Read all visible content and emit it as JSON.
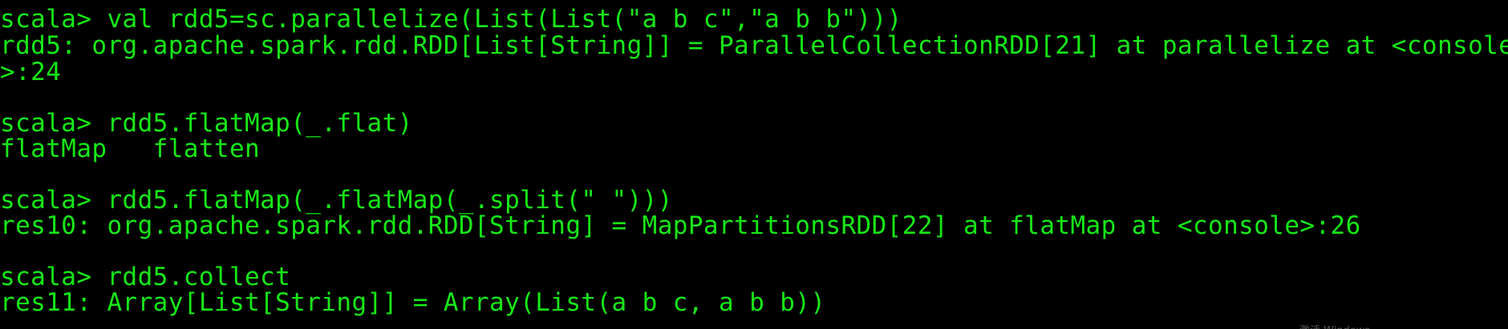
{
  "terminal": {
    "text_color": "#17e817",
    "background_color": "#000000",
    "lines": [
      "scala> val rdd5=sc.parallelize(List(List(\"a b c\",\"a b b\")))",
      "rdd5: org.apache.spark.rdd.RDD[List[String]] = ParallelCollectionRDD[21] at parallelize at <console",
      ">:24",
      "",
      "scala> rdd5.flatMap(_.flat)",
      "flatMap   flatten",
      "",
      "scala> rdd5.flatMap(_.flatMap(_.split(\" \")))",
      "res10: org.apache.spark.rdd.RDD[String] = MapPartitionsRDD[22] at flatMap at <console>:26",
      "",
      "scala> rdd5.collect",
      "res11: Array[List[String]] = Array(List(a b c, a b b))"
    ]
  },
  "watermark": {
    "text": "激活 Windows"
  }
}
